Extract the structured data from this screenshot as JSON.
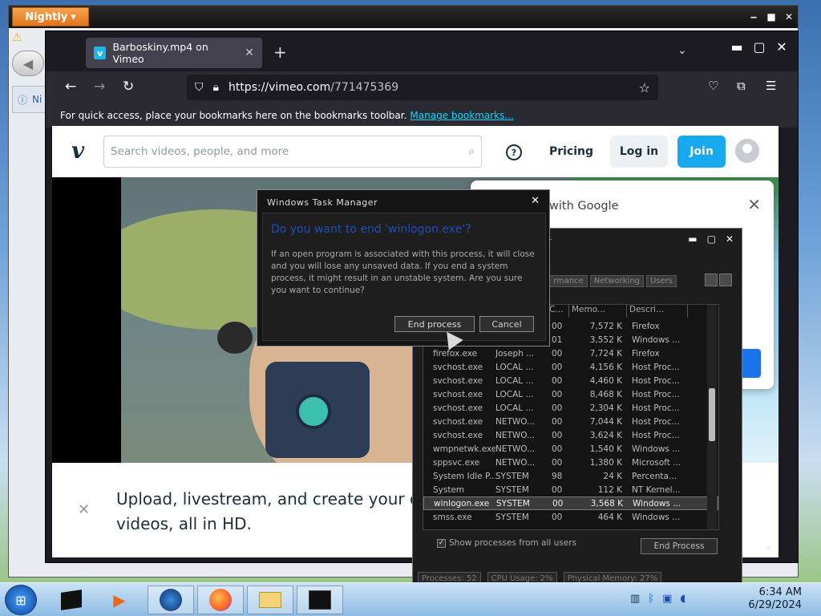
{
  "bg_window": {
    "nightly_label": "Nightly",
    "info_label": "Ni"
  },
  "firefox": {
    "tab_title": "Barboskiny.mp4 on Vimeo",
    "favicon_letter": "v",
    "url_host": "https://vimeo.com",
    "url_path": "/771475369",
    "bookmarks_text": "For quick access, place your bookmarks here on the bookmarks toolbar.",
    "manage_bookmarks": "Manage bookmarks..."
  },
  "vimeo": {
    "logo": "v",
    "search_placeholder": "Search videos, people, and more",
    "help": "?",
    "pricing": "Pricing",
    "login": "Log in",
    "join": "Join",
    "google_title": "with Google",
    "promo_text": "Upload, livestream, and create your own videos, all in HD."
  },
  "taskmgr": {
    "title": "er",
    "tabs": [
      "rmance",
      "Networking",
      "Users"
    ],
    "columns": [
      "C...",
      "Memo...",
      "Descri..."
    ],
    "rows": [
      {
        "name": "",
        "user": "",
        "cpu": "00",
        "mem": "7,572 K",
        "desc": "Firefox"
      },
      {
        "name": "",
        "user": "",
        "cpu": "01",
        "mem": "3,552 K",
        "desc": "Windows ..."
      },
      {
        "name": "firefox.exe",
        "user": "Joseph ...",
        "cpu": "00",
        "mem": "7,724 K",
        "desc": "Firefox"
      },
      {
        "name": "svchost.exe",
        "user": "LOCAL ...",
        "cpu": "00",
        "mem": "4,156 K",
        "desc": "Host Proc..."
      },
      {
        "name": "svchost.exe",
        "user": "LOCAL ...",
        "cpu": "00",
        "mem": "4,460 K",
        "desc": "Host Proc..."
      },
      {
        "name": "svchost.exe",
        "user": "LOCAL ...",
        "cpu": "00",
        "mem": "8,468 K",
        "desc": "Host Proc..."
      },
      {
        "name": "svchost.exe",
        "user": "LOCAL ...",
        "cpu": "00",
        "mem": "2,304 K",
        "desc": "Host Proc..."
      },
      {
        "name": "svchost.exe",
        "user": "NETWO...",
        "cpu": "00",
        "mem": "7,044 K",
        "desc": "Host Proc..."
      },
      {
        "name": "svchost.exe",
        "user": "NETWO...",
        "cpu": "00",
        "mem": "3,624 K",
        "desc": "Host Proc..."
      },
      {
        "name": "wmpnetwk.exe",
        "user": "NETWO...",
        "cpu": "00",
        "mem": "1,540 K",
        "desc": "Windows ..."
      },
      {
        "name": "sppsvc.exe",
        "user": "NETWO...",
        "cpu": "00",
        "mem": "1,380 K",
        "desc": "Microsoft ..."
      },
      {
        "name": "System Idle P...",
        "user": "SYSTEM",
        "cpu": "98",
        "mem": "24 K",
        "desc": "Percenta..."
      },
      {
        "name": "System",
        "user": "SYSTEM",
        "cpu": "00",
        "mem": "112 K",
        "desc": "NT Kernel..."
      },
      {
        "name": "winlogon.exe",
        "user": "SYSTEM",
        "cpu": "00",
        "mem": "3,568 K",
        "desc": "Windows ..."
      },
      {
        "name": "smss.exe",
        "user": "SYSTEM",
        "cpu": "00",
        "mem": "464 K",
        "desc": "Windows ..."
      }
    ],
    "show_all": "Show processes from all users",
    "end_process": "End Process",
    "status": [
      "Processes: 52",
      "CPU Usage: 2%",
      "Physical Memory: 27%"
    ]
  },
  "dialog": {
    "title": "Windows Task Manager",
    "question": "Do you want to end 'winlogon.exe'?",
    "message": "If an open program is associated with this process, it will close and you will lose any unsaved data. If you end a system process, it might result in an unstable system. Are you sure you want to continue?",
    "end_button": "End process",
    "cancel_button": "Cancel"
  },
  "taskbar": {
    "time": "6:34 AM",
    "date": "6/29/2024"
  }
}
